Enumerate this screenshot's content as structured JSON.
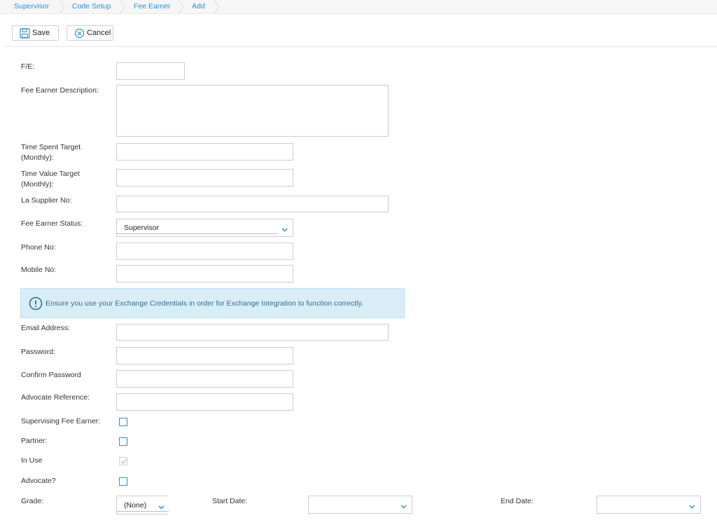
{
  "breadcrumb": [
    "Supervisor",
    "Code Setup",
    "Fee Earner",
    "Add"
  ],
  "toolbar": {
    "save_label": "Save",
    "cancel_label": "Cancel"
  },
  "form": {
    "fe_label": "F/E:",
    "fee_earner_description_label": "Fee Earner Description:",
    "time_spent_target_label_line1": "Time Spent Target",
    "time_spent_target_label_line2": "(Monthly):",
    "time_value_target_label_line1": "Time Value Target",
    "time_value_target_label_line2": "(Monthly):",
    "la_supplier_no_label": "La Supplier No:",
    "fee_earner_status_label": "Fee Earner Status:",
    "fee_earner_status_value": "Supervisor",
    "phone_no_label": "Phone No:",
    "mobile_no_label": "Mobile No:",
    "info_message": "Ensure you use your Exchange Credentials in order for Exchange Integration to function correctly.",
    "email_address_label": "Email Address:",
    "password_label": "Password:",
    "confirm_password_label": "Confirm Password",
    "advocate_reference_label": "Advocate Reference:",
    "supervising_fee_earner_label": "Supervising Fee Earner:",
    "supervising_fee_earner_checked": false,
    "partner_label": "Partner:",
    "partner_checked": false,
    "in_use_label": "In Use",
    "in_use_checked": true,
    "advocate_label": "Advocate?",
    "advocate_checked": false,
    "grade_label": "Grade:",
    "grade_value": "(None)",
    "start_date_label": "Start Date:",
    "start_date_value": "",
    "end_date_label": "End Date:",
    "end_date_value": ""
  },
  "colors": {
    "accent": "#2b8fd4",
    "info_bg": "#d9edf7",
    "info_text": "#31708f"
  }
}
